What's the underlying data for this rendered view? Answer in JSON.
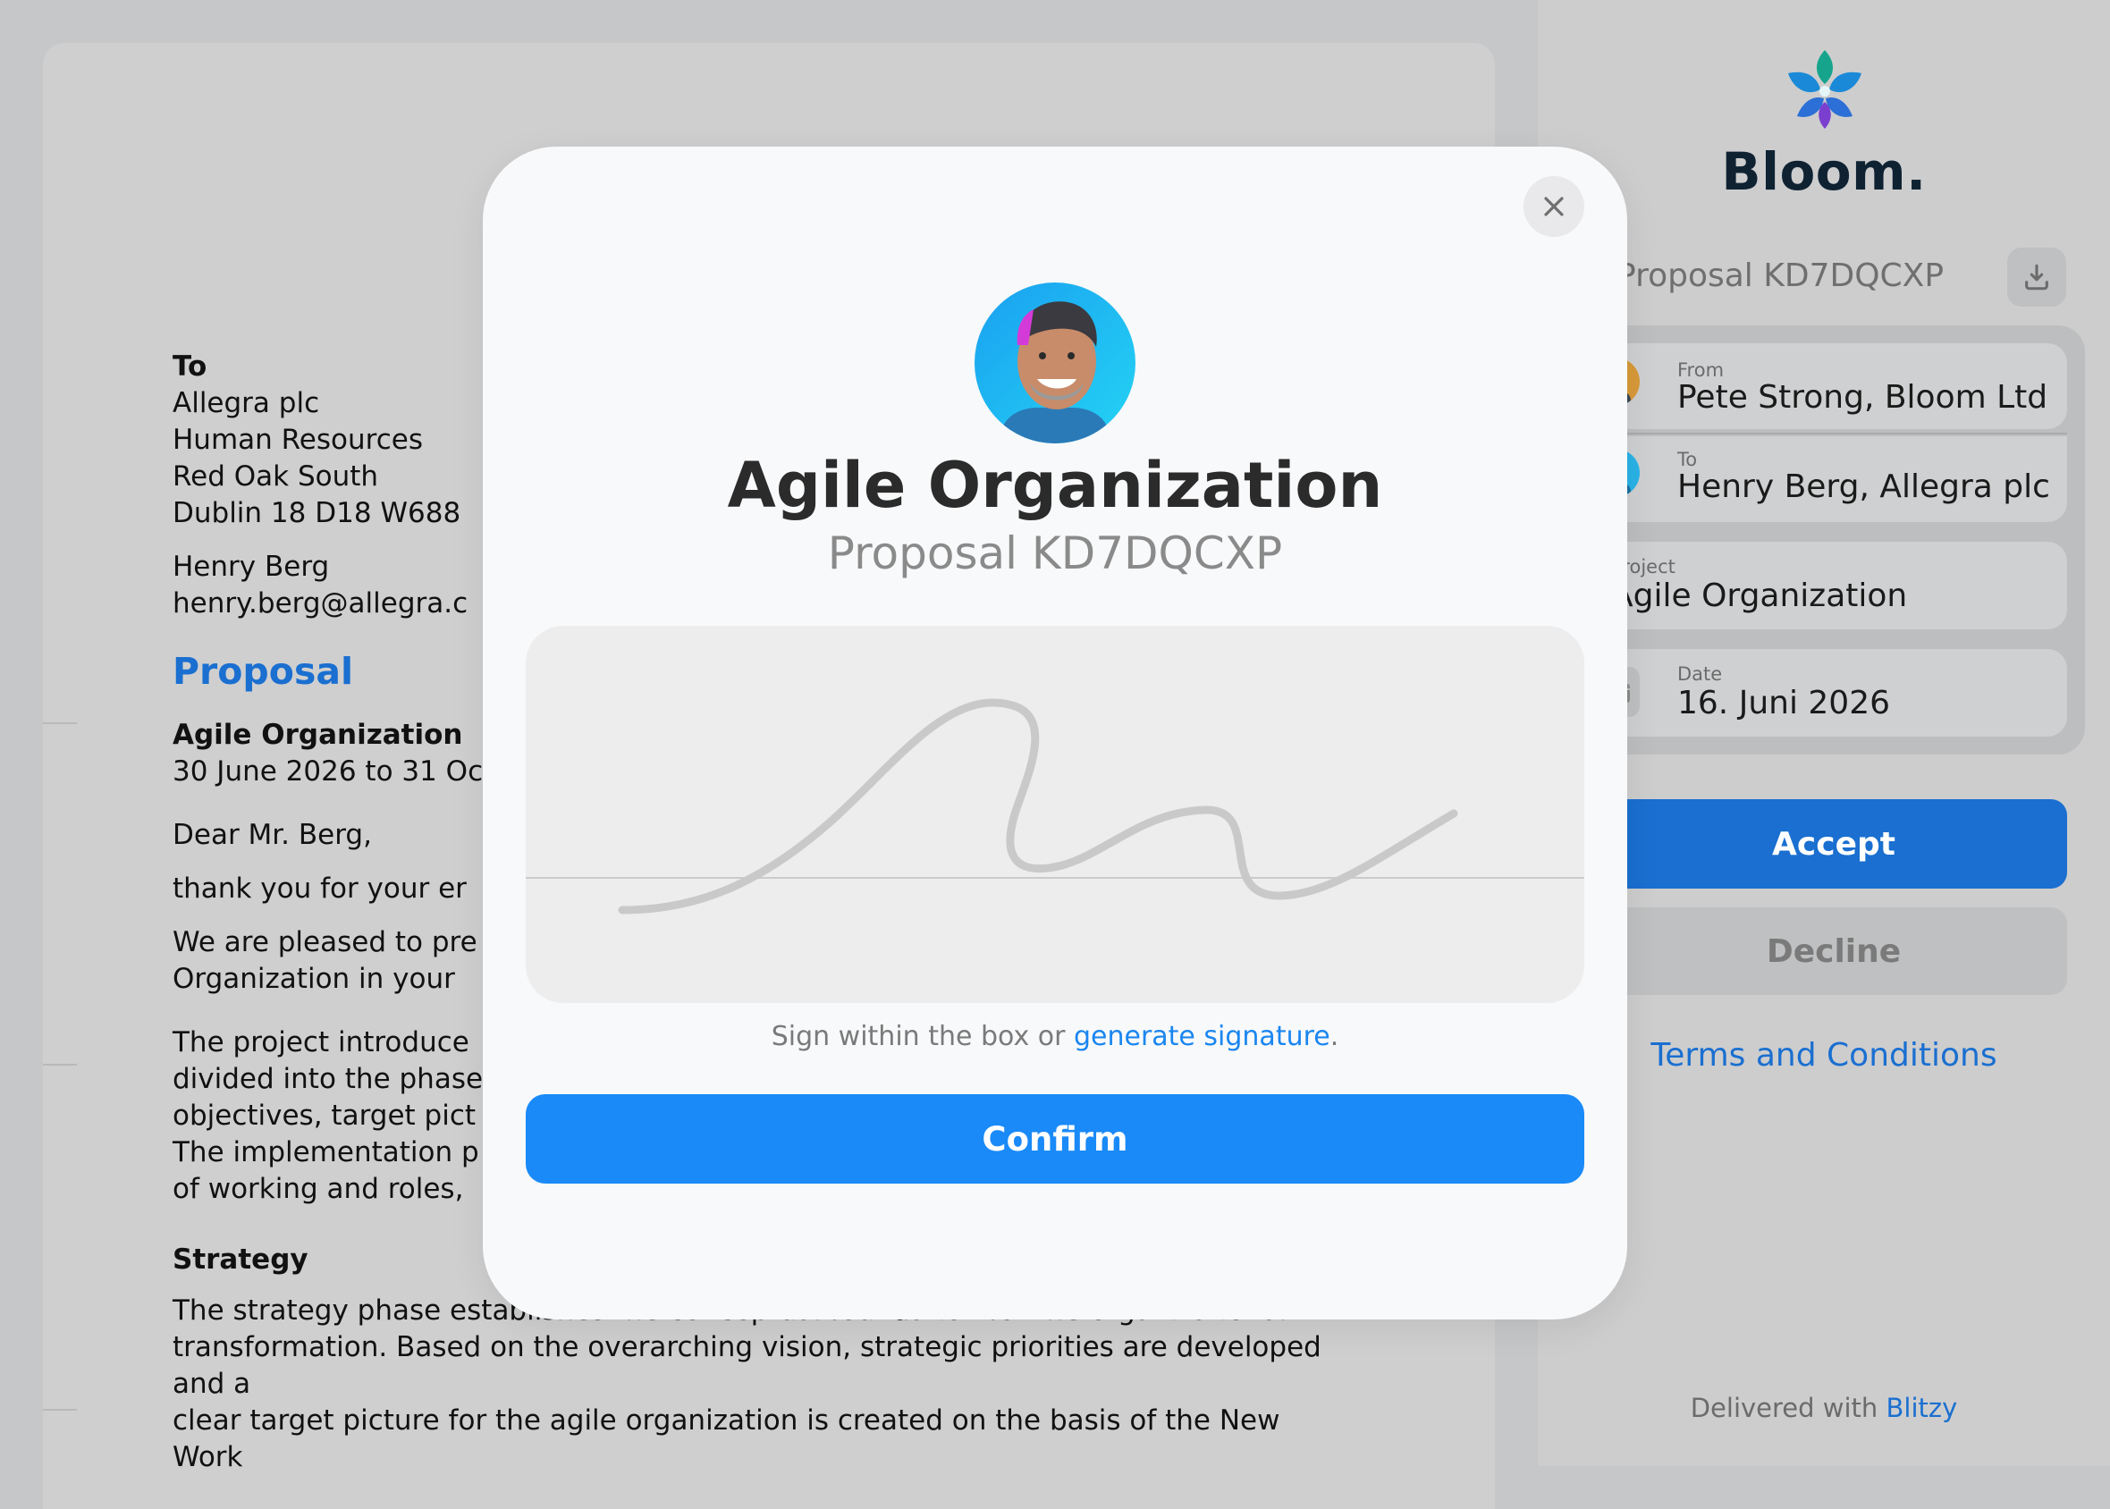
{
  "document": {
    "to_label": "To",
    "address": [
      "Allegra plc",
      "Human Resources",
      "Red Oak South",
      "Dublin 18 D18 W688"
    ],
    "contact_name": "Henry Berg",
    "contact_email": "henry.berg@allegra.c",
    "heading": "Proposal",
    "project_title": "Agile Organization",
    "date_range": "30 June 2026 to 31 Oc",
    "salutation": "Dear Mr. Berg,",
    "para1": "thank you for your er",
    "para2_lines": [
      "We are pleased to pre",
      "Organization in your"
    ],
    "para3_lines": [
      "The project introduce",
      "divided into the phase",
      "objectives, target pict",
      "The implementation p",
      "of working and roles,"
    ],
    "strategy_heading": "Strategy",
    "strategy_lines": [
      "The strategy phase establishes the conceptual foundation for the organizational",
      "transformation. Based on the overarching vision, strategic priorities are developed and a",
      "clear target picture for the agile organization is created on the basis of the New Work"
    ]
  },
  "sidebar": {
    "brand": "Bloom.",
    "proposal_label": "Proposal KD7DQCXP",
    "from_label": "From",
    "from_value": "Pete Strong, Bloom Ltd",
    "to_label": "To",
    "to_value": "Henry Berg, Allegra plc",
    "project_label": "Project",
    "project_value": "Agile Organization",
    "date_label": "Date",
    "date_value": "16. Juni 2026",
    "accept_label": "Accept",
    "decline_label": "Decline",
    "terms_label": "Terms and Conditions",
    "delivered_prefix": "Delivered with ",
    "delivered_brand": "Blitzy"
  },
  "modal": {
    "title": "Agile Organization",
    "subtitle": "Proposal KD7DQCXP",
    "hint_prefix": "Sign within the box or ",
    "hint_link": "generate signature",
    "hint_suffix": ".",
    "confirm_label": "Confirm"
  },
  "colors": {
    "accent": "#1a8af8",
    "link": "#1a6fd0",
    "brand_dark": "#0f2232"
  }
}
